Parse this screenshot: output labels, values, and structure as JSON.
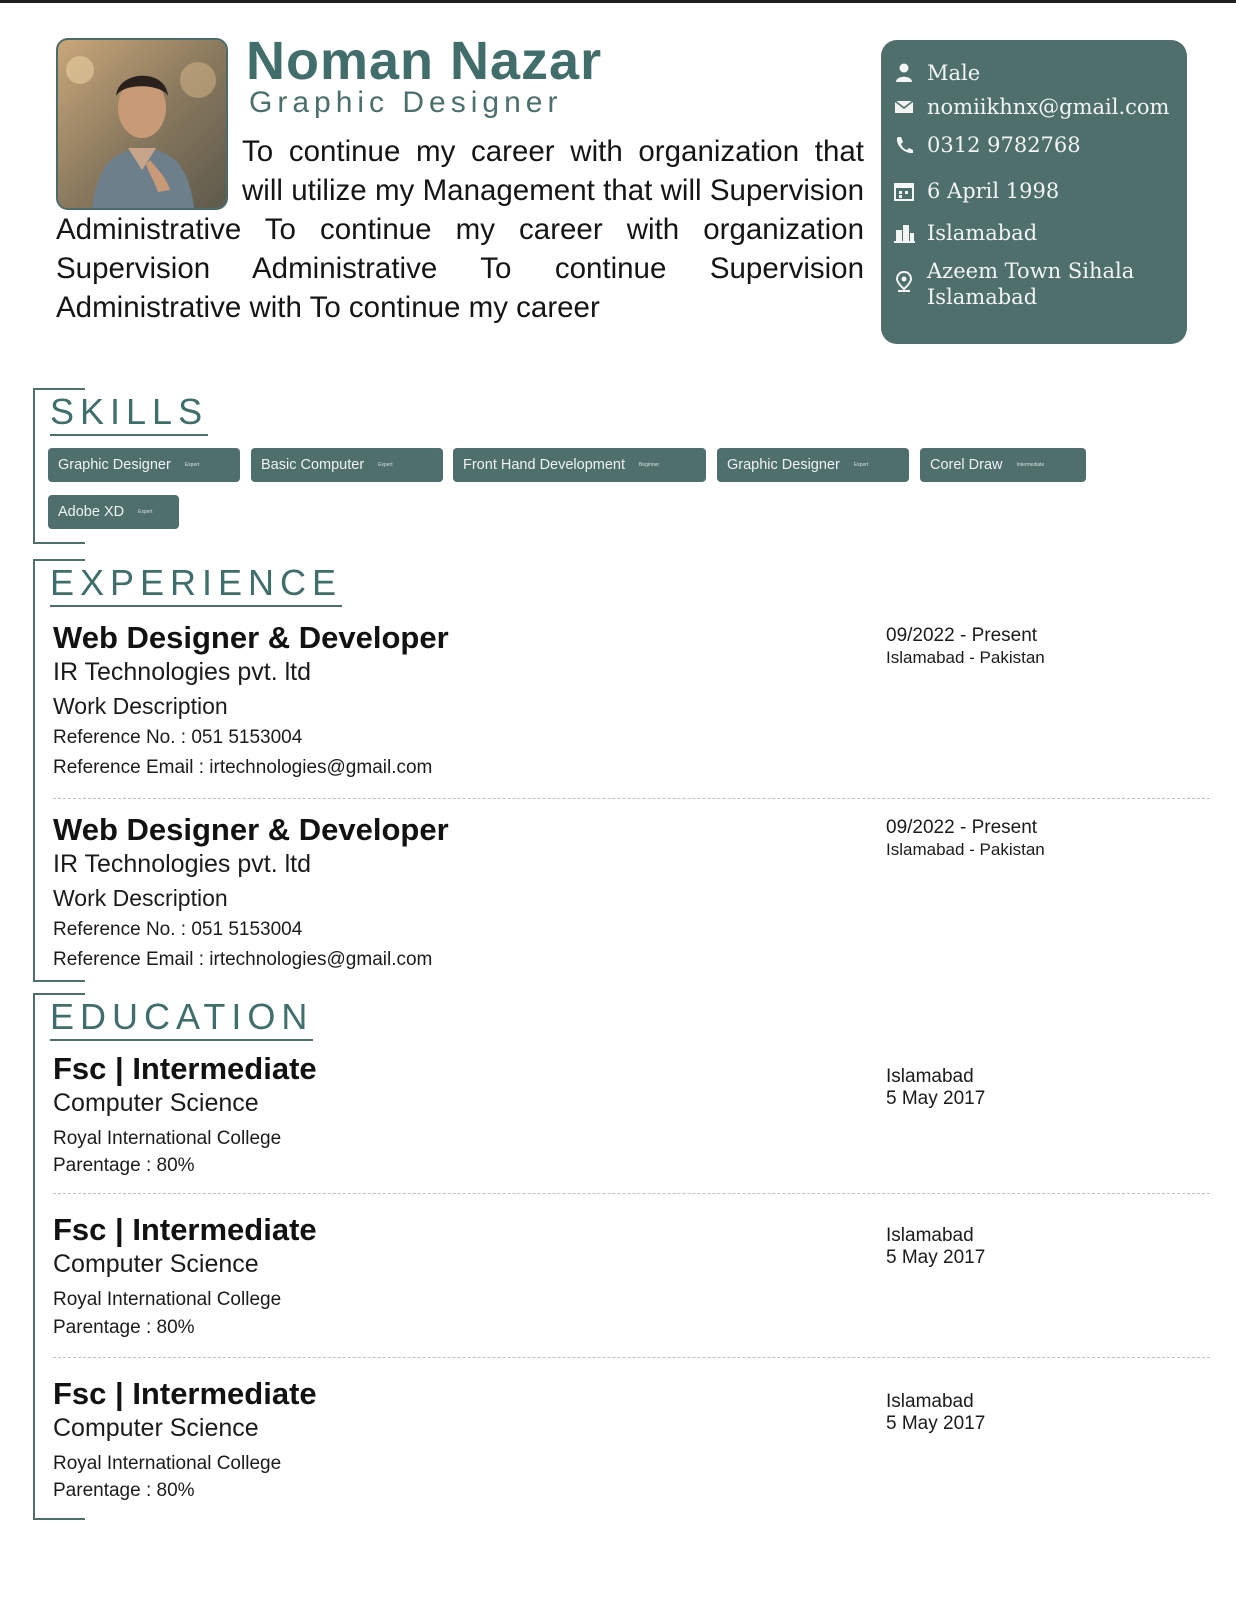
{
  "profile": {
    "name": "Noman Nazar",
    "role": "Graphic Designer",
    "objective": "To continue my career with organization that will utilize my Management that will Supervision Administrative To continue my career with organization Supervision Administrative To continue Supervision Administrative with To continue my career"
  },
  "contact": {
    "gender": "Male",
    "email": "nomiikhnx@gmail.com",
    "phone": "0312 9782768",
    "dob": "6 April 1998",
    "city": "Islamabad",
    "address_line1": "Azeem Town Sihala",
    "address_line2": "Islamabad"
  },
  "skills": {
    "title": "SKILLS",
    "items": [
      {
        "name": "Graphic Designer",
        "level": "Expert"
      },
      {
        "name": "Basic Computer",
        "level": "Expert"
      },
      {
        "name": "Front Hand Development",
        "level": "Beginner"
      },
      {
        "name": "Graphic Designer",
        "level": "Expert"
      },
      {
        "name": "Corel Draw",
        "level": "Intermediate"
      },
      {
        "name": "Adobe XD",
        "level": "Expert"
      }
    ]
  },
  "experience": {
    "title": "EXPERIENCE",
    "items": [
      {
        "position": "Web Designer & Developer",
        "company": "IR Technologies pvt. ltd",
        "description": "Work Description",
        "ref_no": "Reference No. : 051 5153004",
        "ref_email": "Reference Email : irtechnologies@gmail.com",
        "dates": "09/2022 - Present",
        "location": "Islamabad - Pakistan"
      },
      {
        "position": "Web Designer & Developer",
        "company": "IR Technologies pvt. ltd",
        "description": "Work Description",
        "ref_no": "Reference No. : 051 5153004",
        "ref_email": "Reference Email : irtechnologies@gmail.com",
        "dates": "09/2022 - Present",
        "location": "Islamabad - Pakistan"
      }
    ]
  },
  "education": {
    "title": "EDUCATION",
    "items": [
      {
        "degree": "Fsc | Intermediate",
        "field": "Computer Science",
        "institute": "Royal International College",
        "grade": "Parentage : 80%",
        "city": "Islamabad",
        "date": "5 May 2017"
      },
      {
        "degree": "Fsc | Intermediate",
        "field": "Computer Science",
        "institute": "Royal International College",
        "grade": "Parentage : 80%",
        "city": "Islamabad",
        "date": "5 May 2017"
      },
      {
        "degree": "Fsc | Intermediate",
        "field": "Computer Science",
        "institute": "Royal International College",
        "grade": "Parentage : 80%",
        "city": "Islamabad",
        "date": "5 May 2017"
      }
    ]
  },
  "theme": {
    "accent": "#4e6f6c",
    "heading": "#416d6a"
  },
  "icons": [
    "user-icon",
    "mail-icon",
    "phone-icon",
    "calendar-icon",
    "building-icon",
    "location-pin-icon"
  ]
}
